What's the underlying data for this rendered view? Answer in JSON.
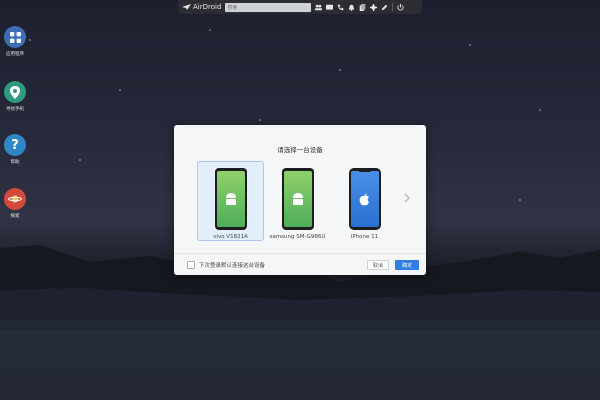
{
  "toolbar": {
    "app_name": "AirDroid",
    "search_placeholder": "搜索",
    "icons": [
      "contacts-icon",
      "messages-icon",
      "phone-icon",
      "notifications-icon",
      "files-icon",
      "settings-icon",
      "edit-icon",
      "power-icon"
    ]
  },
  "desktop": {
    "items": [
      {
        "label": "应用程序",
        "icon": "grid-icon",
        "color": "#3d6db5"
      },
      {
        "label": "寻找手机",
        "icon": "location-pin-icon",
        "color": "#2f9a80"
      },
      {
        "label": "帮助",
        "icon": "question-icon",
        "color": "#2f86c7"
      },
      {
        "label": "探索",
        "icon": "planet-icon",
        "color": "#d14a3a"
      }
    ]
  },
  "dialog": {
    "title": "请选择一台设备",
    "devices": [
      {
        "name": "vivo V1821A",
        "os": "android",
        "selected": true
      },
      {
        "name": "samsung SM-G986U",
        "os": "android",
        "selected": false
      },
      {
        "name": "iPhone 11",
        "os": "ios",
        "selected": false
      }
    ],
    "remember_label": "下次登录默认连接这台设备",
    "cancel_label": "取消",
    "ok_label": "确定"
  },
  "colors": {
    "accent": "#2f7ee4",
    "android_green_top": "#8fd06c",
    "android_green_bottom": "#4fae5a",
    "ios_blue": "#4a8fe8"
  }
}
